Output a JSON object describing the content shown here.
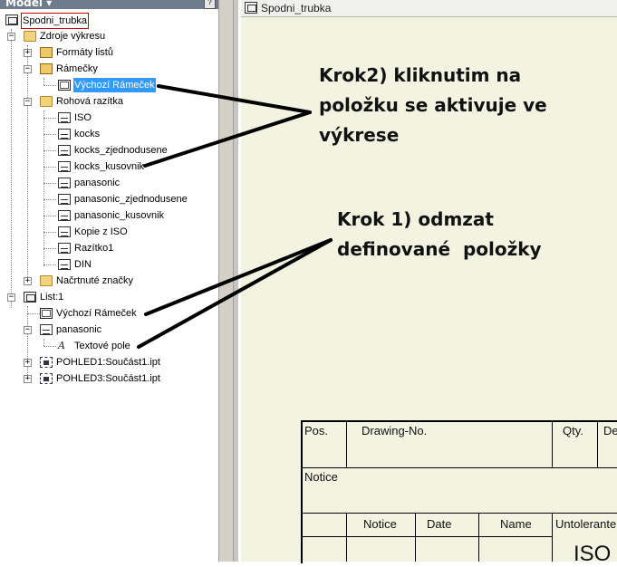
{
  "panel": {
    "title": "Model ▾",
    "help_glyph": "?"
  },
  "tree": {
    "root": "Spodni_trubka",
    "sheet_resources": "Zdroje výkresu",
    "sheet_formats": "Formáty listů",
    "borders": "Rámečky",
    "default_border": "Výchozí Rámeček",
    "title_blocks": "Rohová razítka",
    "title_block_items": [
      "ISO",
      "kocks",
      "kocks_zjednodusene",
      "kocks_kusovnik",
      "panasonic",
      "panasonic_zjednodusene",
      "panasonic_kusovnik",
      "Kopie z ISO",
      "Razítko1",
      "DIN"
    ],
    "sketched_symbols": "Načrtnuté značky",
    "sheet": "List:1",
    "sheet_border": "Výchozí Rámeček",
    "sheet_title_block": "panasonic",
    "text_field": "Textové pole",
    "view1": "POHLED1:Součást1.ipt",
    "view3": "POHLED3:Součást1.ipt",
    "expand_plus": "+",
    "expand_minus": "−",
    "text_icon_glyph": "A"
  },
  "document": {
    "title": "Spodni_trubka"
  },
  "title_block": {
    "pos": "Pos.",
    "drawing_no": "Drawing-No.",
    "qty": "Qty.",
    "de": "De",
    "notice_row": "Notice",
    "notice_col": "Notice",
    "date": "Date",
    "name": "Name",
    "untolerated": "Untolerante",
    "iso": "ISO"
  },
  "annotations": {
    "step2": [
      "Krok2) kliknutim na",
      "položku se aktivuje ve",
      "výkrese"
    ],
    "step1": [
      "Krok 1) odmzat",
      "definované  položky"
    ]
  },
  "colors": {
    "selection": "#3399ff",
    "sheet_bg": "#f3f3e1",
    "panel_header": "#6f7c8e"
  }
}
